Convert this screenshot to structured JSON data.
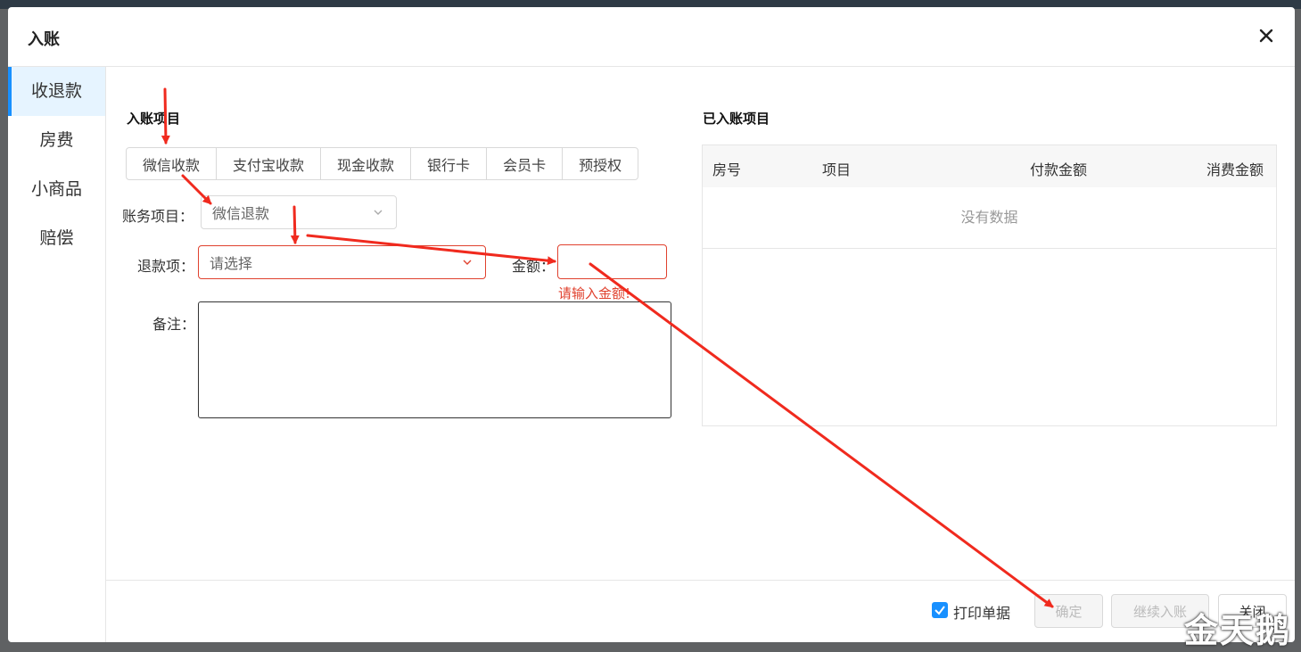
{
  "dialog": {
    "title": "入账",
    "close_icon": "close-icon"
  },
  "sidebar": {
    "items": [
      {
        "label": "收退款",
        "active": true
      },
      {
        "label": "房费",
        "active": false
      },
      {
        "label": "小商品",
        "active": false
      },
      {
        "label": "赔偿",
        "active": false
      }
    ]
  },
  "entry": {
    "section_title": "入账项目",
    "tabs": [
      "微信收款",
      "支付宝收款",
      "现金收款",
      "银行卡",
      "会员卡",
      "预授权"
    ],
    "account_item_label": "账务项目：",
    "account_item_value": "微信退款",
    "refund_item_label": "退款项：",
    "refund_item_placeholder": "请选择",
    "amount_label": "金额：",
    "amount_value": "",
    "amount_error": "请输入金额!",
    "remark_label": "备注：",
    "remark_value": ""
  },
  "posted": {
    "section_title": "已入账项目",
    "columns": [
      "房号",
      "项目",
      "付款金额",
      "消费金额"
    ],
    "empty_text": "没有数据"
  },
  "footer": {
    "print_label": "打印单据",
    "print_checked": true,
    "confirm_label": "确定",
    "continue_label": "继续入账",
    "close_label": "关闭"
  },
  "watermark": "金天鹅",
  "colors": {
    "accent": "#1890ff",
    "error": "#e0412e",
    "annotation_arrow": "#f02a1e"
  }
}
